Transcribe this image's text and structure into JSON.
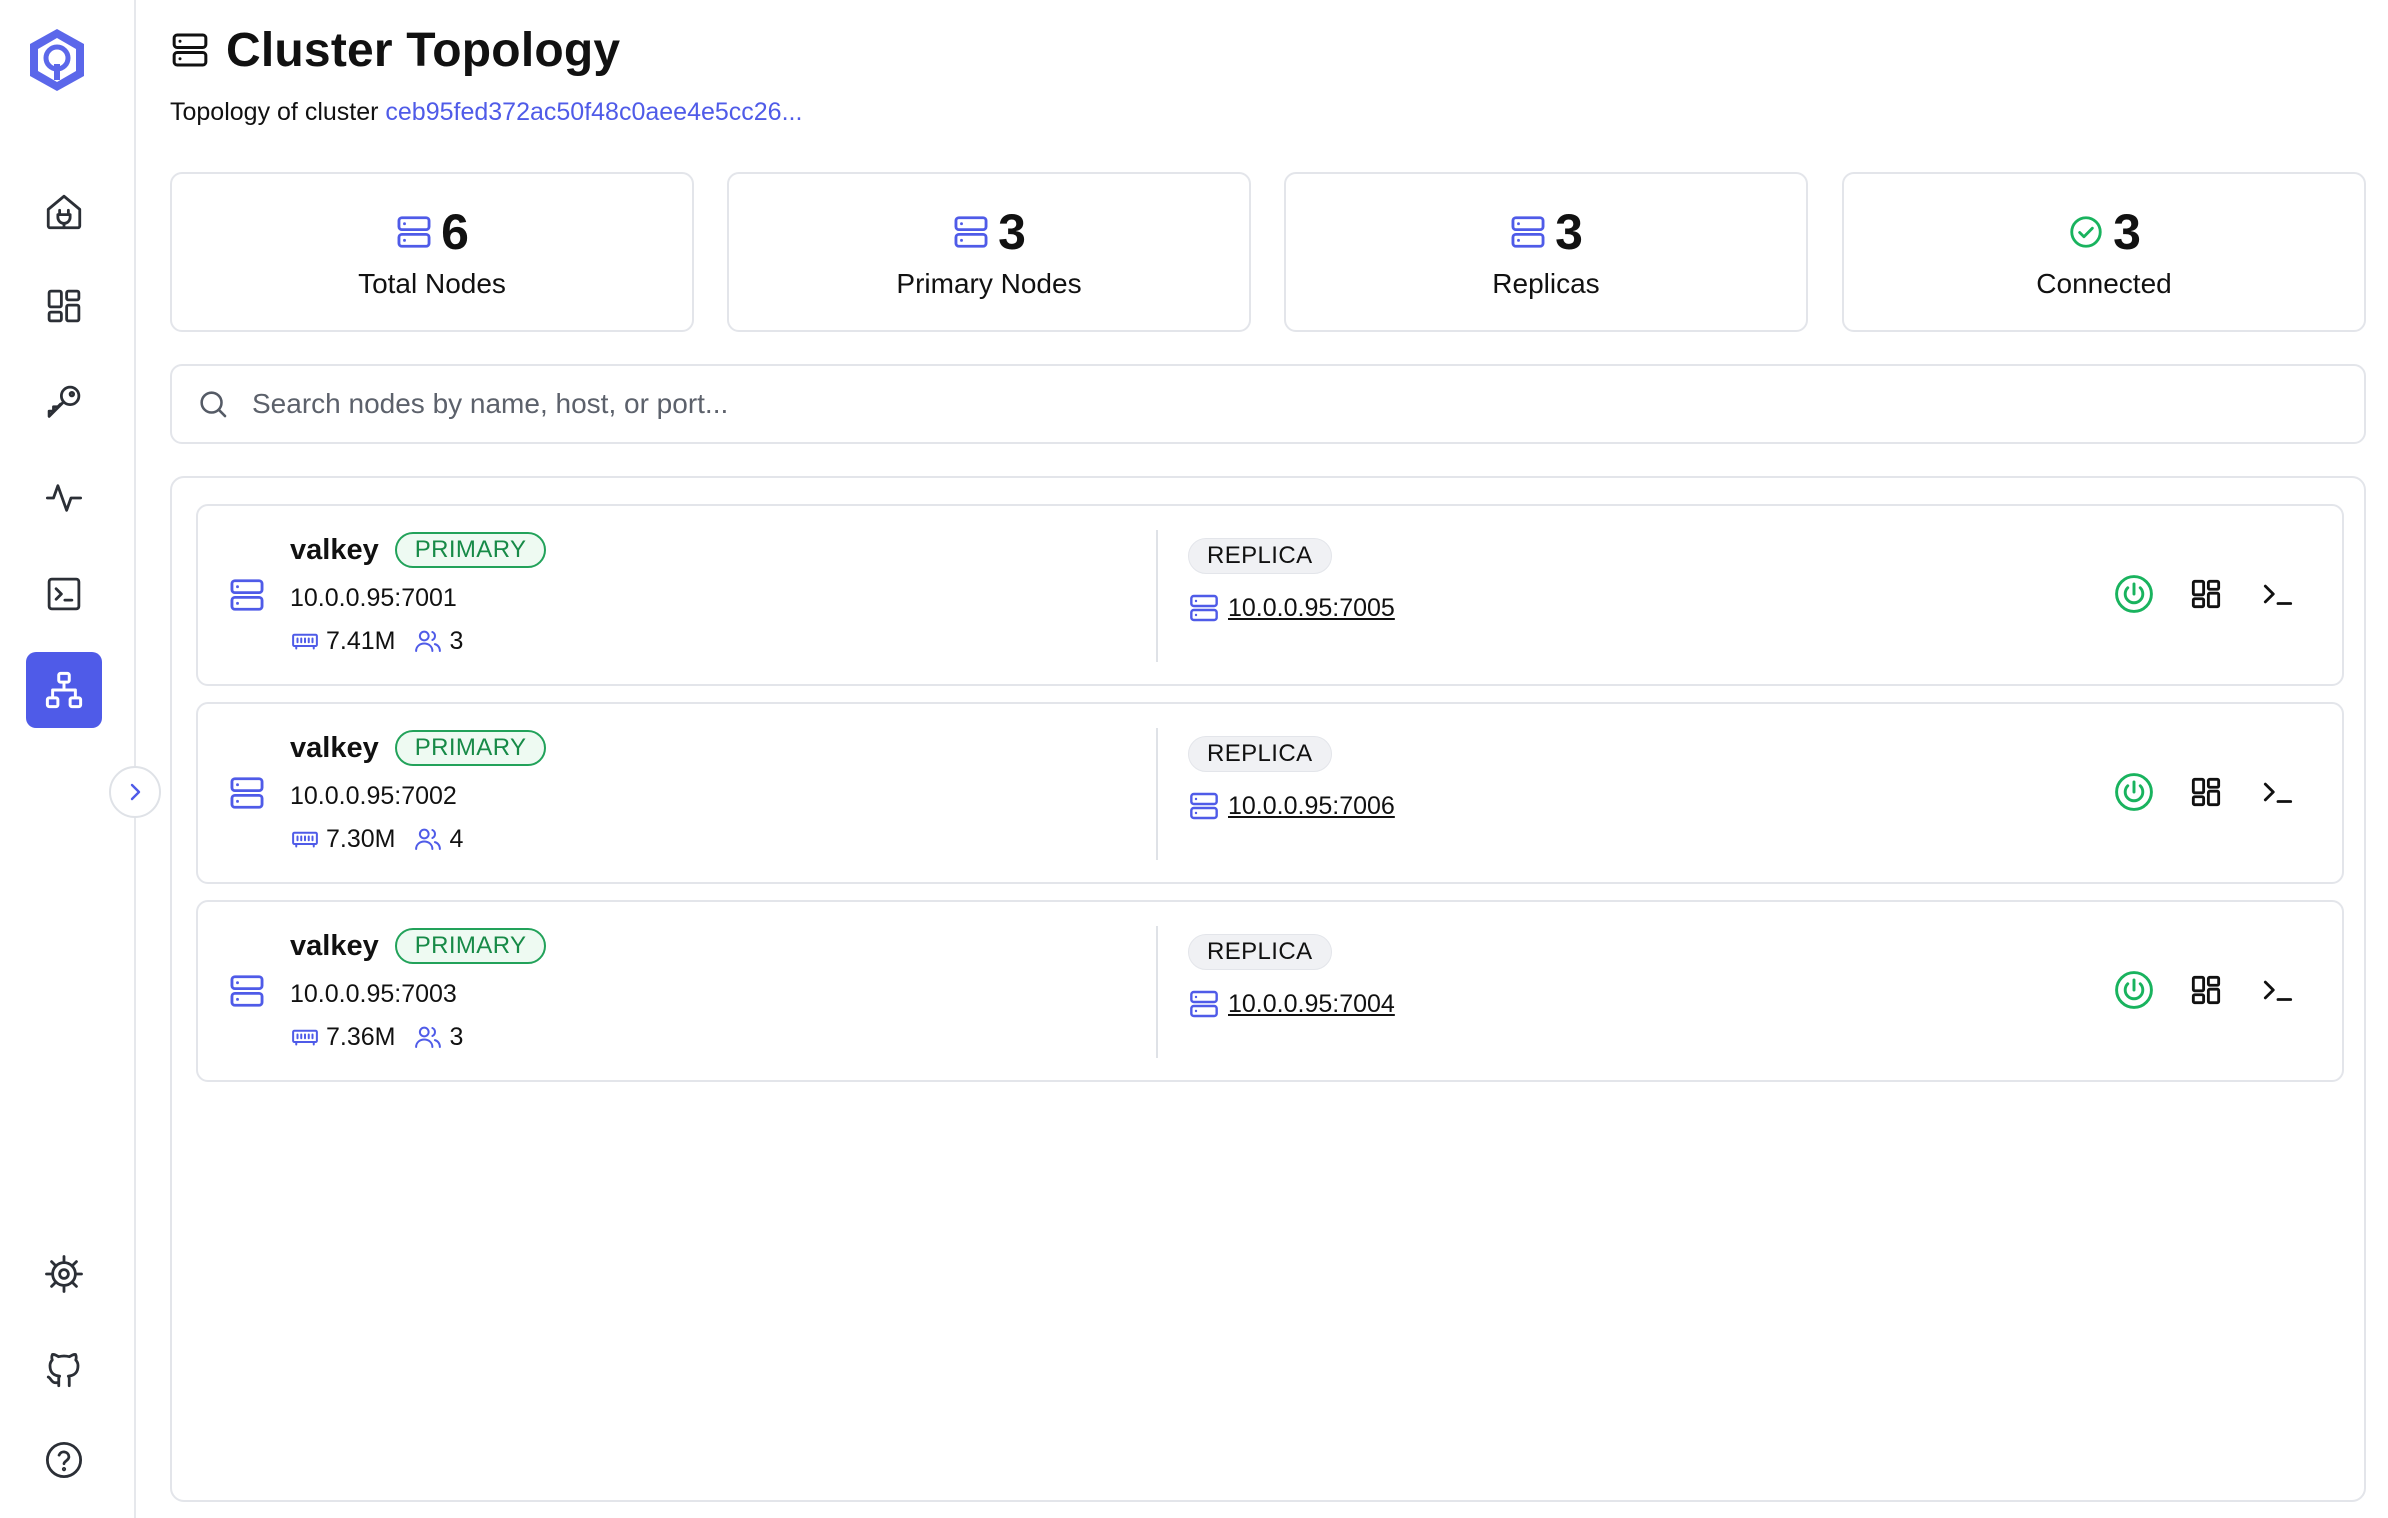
{
  "header": {
    "title": "Cluster Topology",
    "subtitle_prefix": "Topology of cluster",
    "cluster_id": "ceb95fed372ac50f48c0aee4e5cc26..."
  },
  "stats": [
    {
      "value": "6",
      "label": "Total Nodes",
      "icon": "server-icon"
    },
    {
      "value": "3",
      "label": "Primary Nodes",
      "icon": "server-icon"
    },
    {
      "value": "3",
      "label": "Replicas",
      "icon": "server-icon"
    },
    {
      "value": "3",
      "label": "Connected",
      "icon": "check-circle-icon"
    }
  ],
  "search": {
    "placeholder": "Search nodes by name, host, or port..."
  },
  "nodes": [
    {
      "name": "valkey",
      "role": "PRIMARY",
      "host": "10.0.0.95:7001",
      "memory": "7.41M",
      "clients": "3",
      "replica_role": "REPLICA",
      "replica_host": "10.0.0.95:7005"
    },
    {
      "name": "valkey",
      "role": "PRIMARY",
      "host": "10.0.0.95:7002",
      "memory": "7.30M",
      "clients": "4",
      "replica_role": "REPLICA",
      "replica_host": "10.0.0.95:7006"
    },
    {
      "name": "valkey",
      "role": "PRIMARY",
      "host": "10.0.0.95:7003",
      "memory": "7.36M",
      "clients": "3",
      "replica_role": "REPLICA",
      "replica_host": "10.0.0.95:7004"
    }
  ],
  "sidebar": {
    "items": [
      "connection-icon",
      "dashboard-icon",
      "key-icon",
      "activity-icon",
      "terminal-icon",
      "topology-icon",
      "settings-icon",
      "github-icon",
      "help-icon"
    ],
    "active": "topology-icon"
  },
  "colors": {
    "accent": "#4f5be8",
    "success": "#19b35e",
    "border": "#e3e5ea"
  }
}
